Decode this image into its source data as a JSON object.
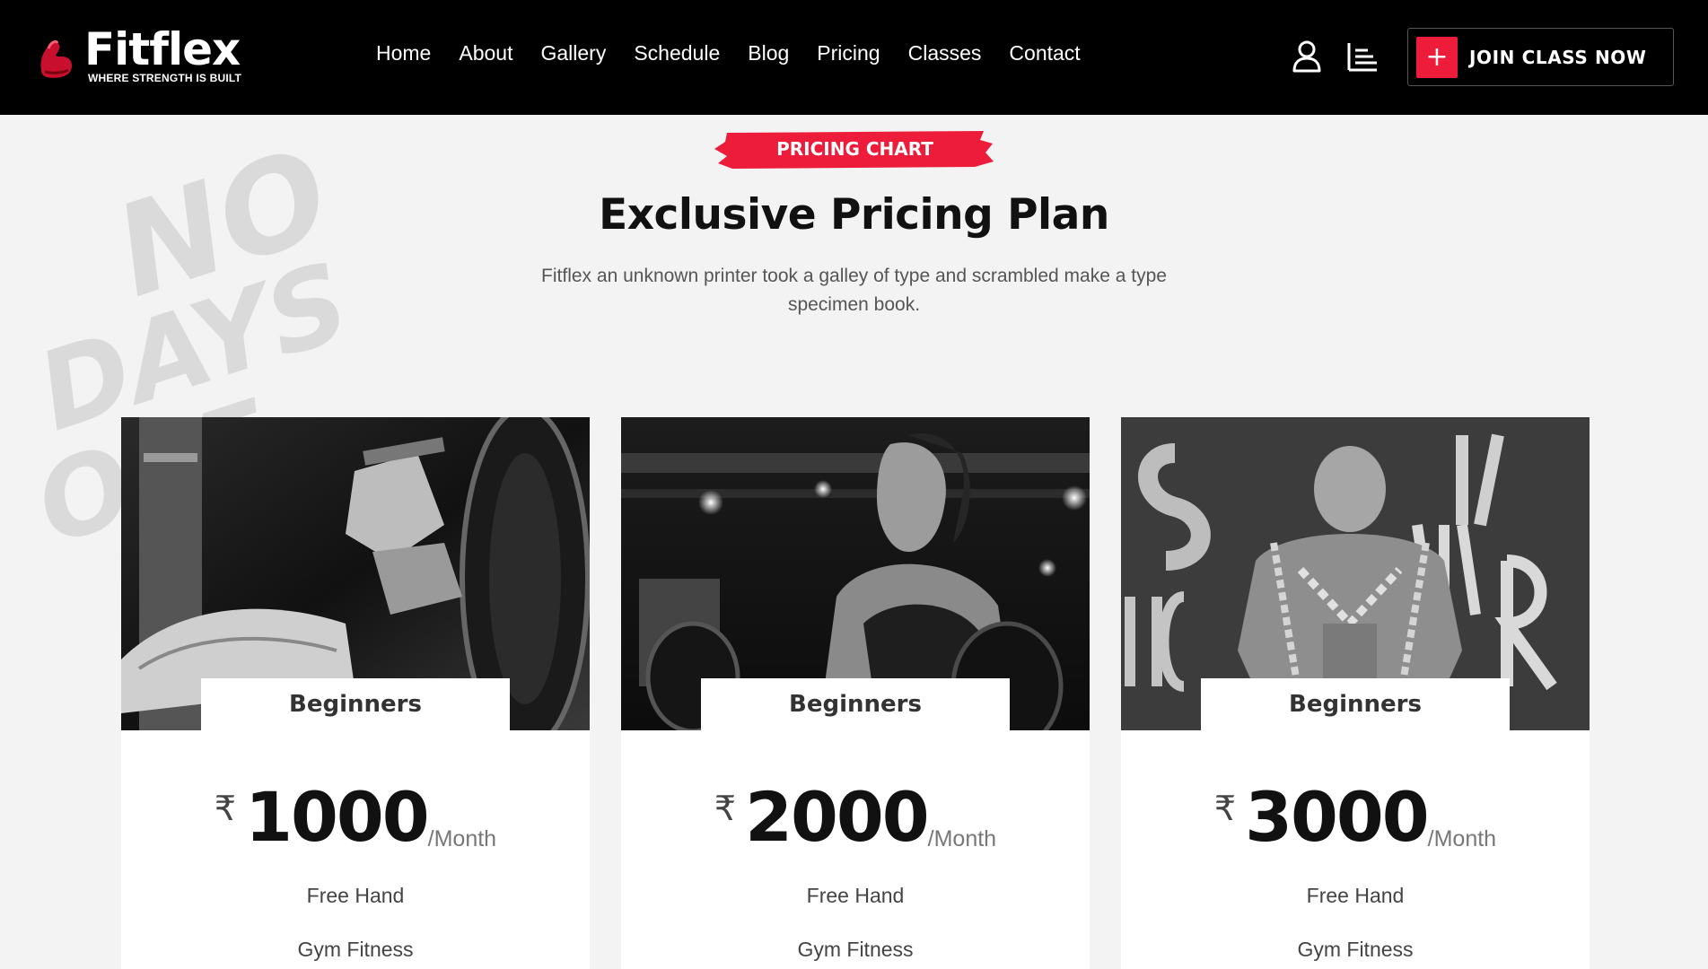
{
  "brand": {
    "name": "Fitflex",
    "tagline": "WHERE STRENGTH IS BUILT",
    "icon": "flexed-arm-logo"
  },
  "nav": {
    "items": [
      "Home",
      "About",
      "Gallery",
      "Schedule",
      "Blog",
      "Pricing",
      "Classes",
      "Contact"
    ]
  },
  "header_actions": {
    "user_icon": "user-icon",
    "menu_icon": "list-icon",
    "join_label": "JOIN CLASS NOW",
    "join_icon": "plus-icon"
  },
  "section": {
    "badge": "PRICING CHART",
    "title": "Exclusive Pricing Plan",
    "description": "Fitflex an unknown printer took a galley of type and scrambled make a type specimen book."
  },
  "background": {
    "graffiti_text": [
      "NO",
      "DAYS",
      "OFF"
    ]
  },
  "colors": {
    "accent": "#ec1c3a",
    "header_bg": "#000000",
    "page_bg": "#f3f3f3"
  },
  "plans": [
    {
      "name": "Beginners",
      "currency": "₹",
      "price": "1000",
      "period": "/Month",
      "features": [
        "Free Hand",
        "Gym Fitness"
      ]
    },
    {
      "name": "Beginners",
      "currency": "₹",
      "price": "2000",
      "period": "/Month",
      "features": [
        "Free Hand",
        "Gym Fitness"
      ]
    },
    {
      "name": "Beginners",
      "currency": "₹",
      "price": "3000",
      "period": "/Month",
      "features": [
        "Free Hand",
        "Gym Fitness"
      ]
    }
  ]
}
